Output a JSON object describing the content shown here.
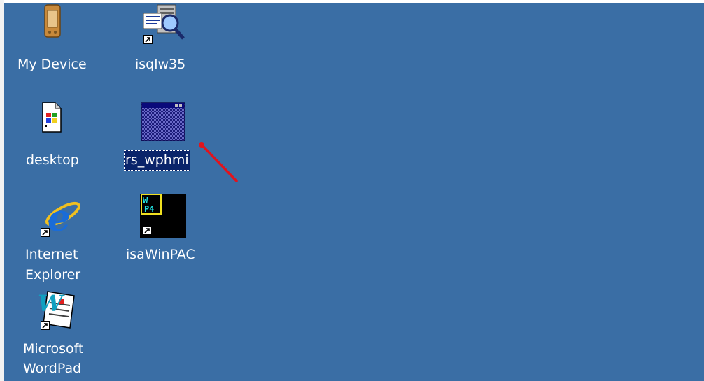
{
  "desktop": {
    "background_color": "#3a6ea5",
    "icons": [
      {
        "id": "my-device",
        "label": "My Device",
        "icon": "pda-device-icon",
        "shortcut": false
      },
      {
        "id": "isqlw35",
        "label": "isqlw35",
        "icon": "query-analyzer-icon",
        "shortcut": true
      },
      {
        "id": "desktop",
        "label": "desktop",
        "icon": "windows-document-icon",
        "shortcut": false
      },
      {
        "id": "rs-wphmi",
        "label": "rs_wphmi",
        "icon": "application-window-icon",
        "shortcut": false,
        "selected": true
      },
      {
        "id": "internet-explorer",
        "label_lines": [
          "Internet",
          "Explorer"
        ],
        "icon": "internet-explorer-icon",
        "shortcut": true
      },
      {
        "id": "isawinpac",
        "label": "isaWinPAC",
        "icon": "wp4-console-icon",
        "shortcut": true
      },
      {
        "id": "wordpad",
        "label_lines": [
          "Microsoft",
          "WordPad"
        ],
        "icon": "wordpad-icon",
        "shortcut": true
      }
    ]
  },
  "annotation": {
    "color": "#e0141e",
    "icon": "red-arrow-annotation"
  },
  "wp4_label": "WP4"
}
